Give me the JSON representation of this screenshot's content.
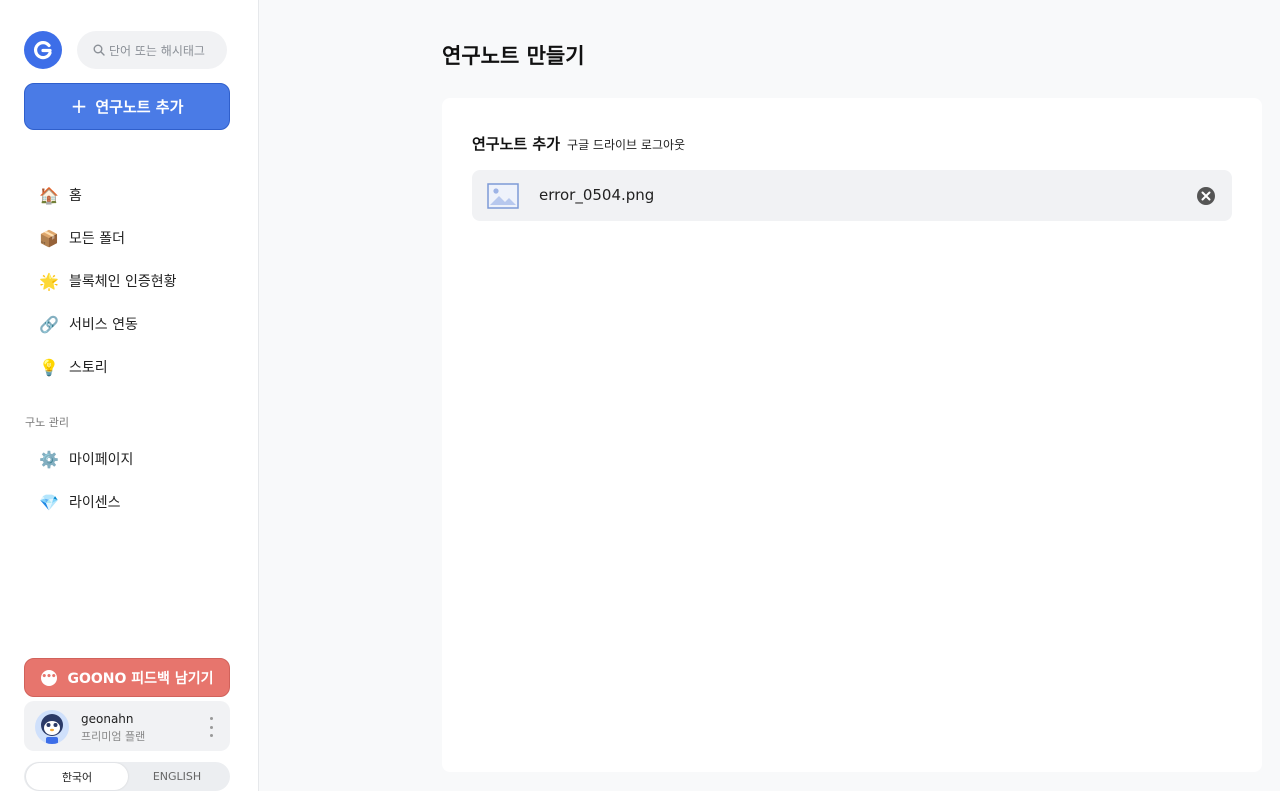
{
  "sidebar": {
    "search_placeholder": "단어 또는 해시태그",
    "add_button_label": "연구노트 추가",
    "nav_items": [
      {
        "icon": "house-icon",
        "emoji": "🏠",
        "label": "홈"
      },
      {
        "icon": "folder-box-icon",
        "emoji": "📦",
        "label": "모든 폴더"
      },
      {
        "icon": "star-icon",
        "emoji": "🌟",
        "label": "블록체인 인증현황"
      },
      {
        "icon": "link-icon",
        "emoji": "🔗",
        "label": "서비스 연동"
      },
      {
        "icon": "lightbulb-icon",
        "emoji": "💡",
        "label": "스토리"
      }
    ],
    "section_label": "구노 관리",
    "manage_items": [
      {
        "icon": "gear-icon",
        "emoji": "⚙️",
        "label": "마이페이지"
      },
      {
        "icon": "gem-icon",
        "emoji": "💎",
        "label": "라이센스"
      }
    ],
    "feedback_label": "GOONO 피드백 남기기",
    "profile": {
      "username": "geonahn",
      "plan": "프리미엄 플랜"
    },
    "languages": {
      "active": "한국어",
      "inactive": "ENGLISH"
    }
  },
  "main": {
    "page_title": "연구노트 만들기",
    "card": {
      "title": "연구노트 추가",
      "logout_link": "구글 드라이브 로그아웃",
      "file": {
        "name": "error_0504.png",
        "icon": "image-file-icon"
      }
    }
  },
  "colors": {
    "primary": "#4a7be6",
    "feedback": "#e7756d",
    "background": "#f8f9fa"
  }
}
